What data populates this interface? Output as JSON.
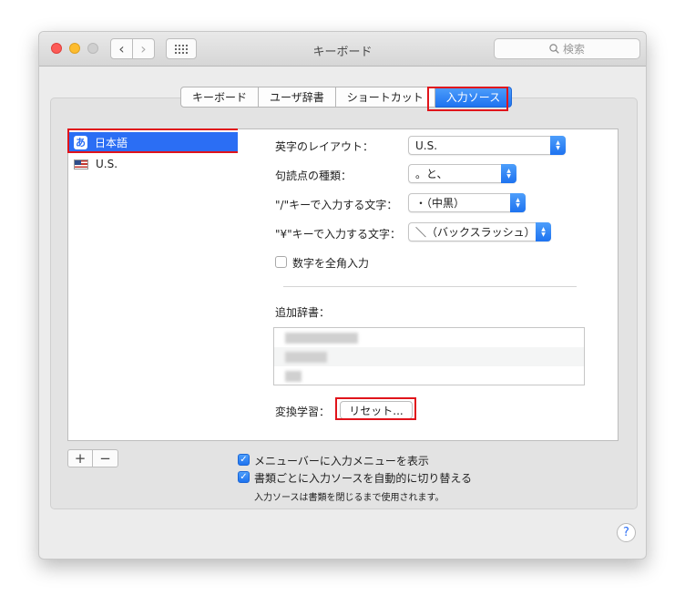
{
  "window": {
    "title": "キーボード",
    "search_placeholder": "検索",
    "back_glyph": "‹",
    "forward_glyph": "›"
  },
  "tabs": [
    {
      "label": "キーボード",
      "active": false
    },
    {
      "label": "ユーザ辞書",
      "active": false
    },
    {
      "label": "ショートカット",
      "active": false
    },
    {
      "label": "入力ソース",
      "active": true
    }
  ],
  "sources": [
    {
      "label": "日本語",
      "icon": "あ",
      "selected": true
    },
    {
      "label": "U.S.",
      "icon": "us-flag-icon",
      "selected": false
    }
  ],
  "settings": {
    "romaji_layout_label": "英字のレイアウト：",
    "romaji_layout_value": "U.S.",
    "punctuation_label": "句読点の種類：",
    "punctuation_value": "。と、",
    "slash_label": "\"/\"キーで入力する文字：",
    "slash_value": "・（中黒）",
    "yen_label": "\"¥\"キーで入力する文字：",
    "yen_value": "＼（バックスラッシュ）",
    "fullwidth_numerals_label": "数字を全角入力",
    "fullwidth_numerals_checked": false,
    "additional_dict_label": "追加辞書：",
    "conversion_learning_label": "変換学習：",
    "reset_button_label": "リセット..."
  },
  "bottom": {
    "add_label": "+",
    "remove_label": "−",
    "show_input_menu_label": "メニューバーに入力メニューを表示",
    "show_input_menu_checked": true,
    "auto_switch_label": "書類ごとに入力ソースを自動的に切り替える",
    "auto_switch_checked": true,
    "note": "入力ソースは書類を閉じるまで使用されます。",
    "help_label": "?"
  },
  "colors": {
    "accent": "#2b6ef4",
    "highlight_box": "#e0141b"
  }
}
